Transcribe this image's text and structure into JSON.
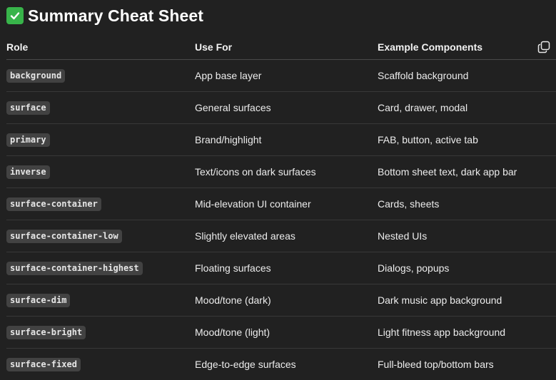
{
  "heading": {
    "icon": "check-mark-button-icon",
    "text": "Summary Cheat Sheet"
  },
  "table": {
    "headers": [
      "Role",
      "Use For",
      "Example Components"
    ],
    "copy_icon": "copy-icon",
    "rows": [
      {
        "role": "background",
        "use_for": "App base layer",
        "examples": "Scaffold background"
      },
      {
        "role": "surface",
        "use_for": "General surfaces",
        "examples": "Card, drawer, modal"
      },
      {
        "role": "primary",
        "use_for": "Brand/highlight",
        "examples": "FAB, button, active tab"
      },
      {
        "role": "inverse",
        "use_for": "Text/icons on dark surfaces",
        "examples": "Bottom sheet text, dark app bar"
      },
      {
        "role": "surface-container",
        "use_for": "Mid-elevation UI container",
        "examples": "Cards, sheets"
      },
      {
        "role": "surface-container-low",
        "use_for": "Slightly elevated areas",
        "examples": "Nested UIs"
      },
      {
        "role": "surface-container-highest",
        "use_for": "Floating surfaces",
        "examples": "Dialogs, popups"
      },
      {
        "role": "surface-dim",
        "use_for": "Mood/tone (dark)",
        "examples": "Dark music app background"
      },
      {
        "role": "surface-bright",
        "use_for": "Mood/tone (light)",
        "examples": "Light fitness app background"
      },
      {
        "role": "surface-fixed",
        "use_for": "Edge-to-edge surfaces",
        "examples": "Full-bleed top/bottom bars"
      }
    ]
  },
  "colors": {
    "background": "#212121",
    "text": "#ececec",
    "code_background": "#424242",
    "check_green": "#38b44a"
  }
}
